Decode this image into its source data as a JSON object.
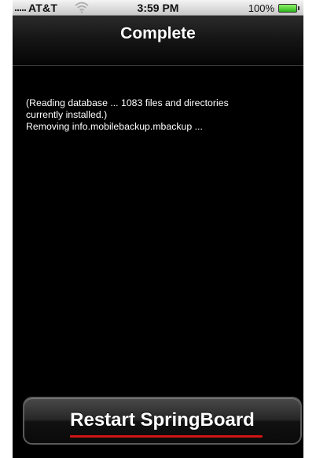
{
  "status_bar": {
    "carrier": "AT&T",
    "time": "3:59 PM",
    "battery_percent": "100%",
    "battery_level": 1.0,
    "icons": [
      "signal-icon",
      "wifi-icon",
      "battery-icon"
    ]
  },
  "nav": {
    "title": "Complete"
  },
  "log": {
    "lines": [
      "(Reading database ... 1083 files and directories",
      "currently installed.)",
      "Removing info.mobilebackup.mbackup ..."
    ]
  },
  "restart_button": {
    "label": "Restart SpringBoard",
    "underline_color": "#d21414"
  },
  "colors": {
    "background": "#000000",
    "text": "#ffffff",
    "battery_fill": "#2db61c"
  }
}
